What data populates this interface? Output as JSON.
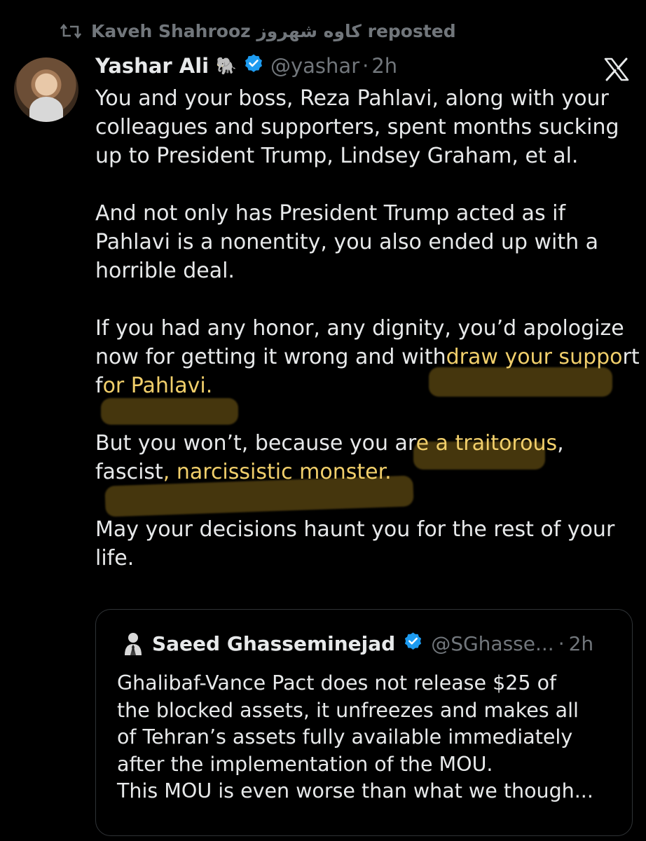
{
  "repost": {
    "icon": "repost-icon",
    "text": "Kaveh Shahrooz کاوه شهروز reposted"
  },
  "post": {
    "author_name": "Yashar Ali",
    "name_emoji": "🐘",
    "verified_icon": "verified-badge-icon",
    "handle": "@yashar",
    "separator": "·",
    "time": "2h",
    "platform_icon": "x-logo-icon",
    "paragraphs": [
      {
        "lines": [
          [
            {
              "t": "You and your boss, Reza Pahlavi, along with your"
            }
          ],
          [
            {
              "t": "colleagues and supporters, spent months sucking"
            }
          ],
          [
            {
              "t": "up to President Trump, Lindsey Graham, et al."
            }
          ]
        ]
      },
      {
        "lines": [
          [
            {
              "t": "And not only has President Trump acted as if"
            }
          ],
          [
            {
              "t": "Pahlavi is a nonentity, you also ended up with a"
            }
          ],
          [
            {
              "t": "horrible deal."
            }
          ]
        ]
      },
      {
        "lines": [
          [
            {
              "t": "If you had any honor, any dignity, you’d apologize"
            }
          ],
          [
            {
              "t": "now for getting it wrong and with"
            },
            {
              "t": "draw your suppo",
              "hl": true
            },
            {
              "t": "rt"
            }
          ],
          [
            {
              "t": "f"
            },
            {
              "t": "or Pahlavi.",
              "hl": true
            }
          ]
        ]
      },
      {
        "lines": [
          [
            {
              "t": "But you won’t, because you ar"
            },
            {
              "t": "e a traitorous",
              "hl": true
            },
            {
              "t": ","
            }
          ],
          [
            {
              "t": "fascist"
            },
            {
              "t": ", narcissistic monster.",
              "hl": true
            }
          ]
        ]
      },
      {
        "lines": [
          [
            {
              "t": "May your decisions haunt you for the rest of your"
            }
          ],
          [
            {
              "t": "life."
            }
          ]
        ]
      }
    ],
    "highlight_color": "#f1cf6b"
  },
  "quote": {
    "avatar_icon": "suited-man-avatar",
    "author_name": "Saeed Ghasseminejad",
    "verified_icon": "verified-badge-icon",
    "handle": "@SGhasse...",
    "separator": "·",
    "time": "2h",
    "lines": [
      "Ghalibaf-Vance Pact does not release $25 of",
      "the blocked assets, it unfreezes and makes all",
      "of Tehran’s assets fully available immediately",
      "after the implementation of the MOU.",
      "This MOU is even worse than what we though..."
    ]
  },
  "colors": {
    "background": "#000000",
    "text": "#e7e9ea",
    "secondary": "#71767b",
    "verified": "#1d9bf0",
    "border": "#2f3336"
  }
}
